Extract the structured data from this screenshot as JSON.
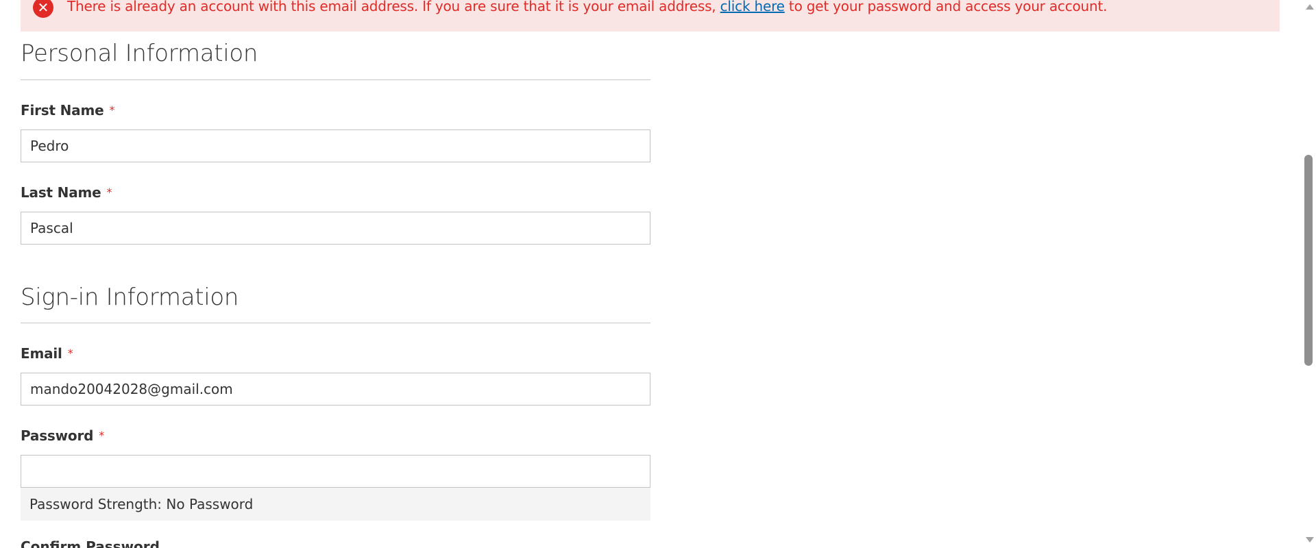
{
  "error_banner": {
    "message_before": "There is already an account with this email address. If you are sure that it is your email address, ",
    "link_text": "click here",
    "message_after": " to get your password and access your account.",
    "icon": "error-x-icon",
    "icon_glyph": "✕"
  },
  "personal_info": {
    "title": "Personal Information",
    "first_name": {
      "label": "First Name",
      "required_mark": "*",
      "value": "Pedro"
    },
    "last_name": {
      "label": "Last Name",
      "required_mark": "*",
      "value": "Pascal"
    }
  },
  "signin_info": {
    "title": "Sign-in Information",
    "email": {
      "label": "Email",
      "required_mark": "*",
      "value": "mando20042028@gmail.com"
    },
    "password": {
      "label": "Password",
      "required_mark": "*",
      "value": "",
      "strength_text": "Password Strength: No Password"
    },
    "confirm_password": {
      "label": "Confirm Password"
    }
  },
  "colors": {
    "error_text": "#e02b27",
    "error_background": "#fae5e5",
    "link": "#006bb4",
    "required_star": "#e02b27"
  }
}
